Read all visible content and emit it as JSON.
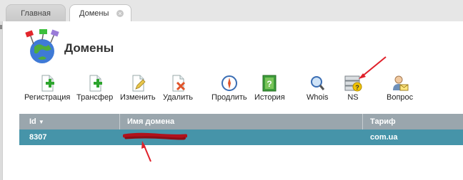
{
  "tabs": [
    {
      "label": "Главная"
    },
    {
      "label": "Домены"
    }
  ],
  "page": {
    "title": "Домены"
  },
  "toolbar": [
    {
      "label": "Регистрация",
      "icon": "doc-plus-icon"
    },
    {
      "label": "Трансфер",
      "icon": "doc-plus-icon"
    },
    {
      "label": "Изменить",
      "icon": "doc-edit-icon"
    },
    {
      "label": "Удалить",
      "icon": "doc-delete-icon"
    },
    {
      "label": "Продлить",
      "icon": "compass-icon"
    },
    {
      "label": "История",
      "icon": "history-icon"
    },
    {
      "label": "Whois",
      "icon": "magnifier-icon"
    },
    {
      "label": "NS",
      "icon": "server-question-icon"
    },
    {
      "label": "Вопрос",
      "icon": "user-mail-icon"
    }
  ],
  "table": {
    "columns": [
      "Id",
      "Имя домена",
      "Тариф"
    ],
    "rows": [
      {
        "id": "8307",
        "domain": "",
        "tariff": "com.ua"
      }
    ]
  },
  "colors": {
    "header_bg": "#9aa6ad",
    "selected_row": "#4694a9",
    "annotation_arrow": "#e0202a"
  }
}
